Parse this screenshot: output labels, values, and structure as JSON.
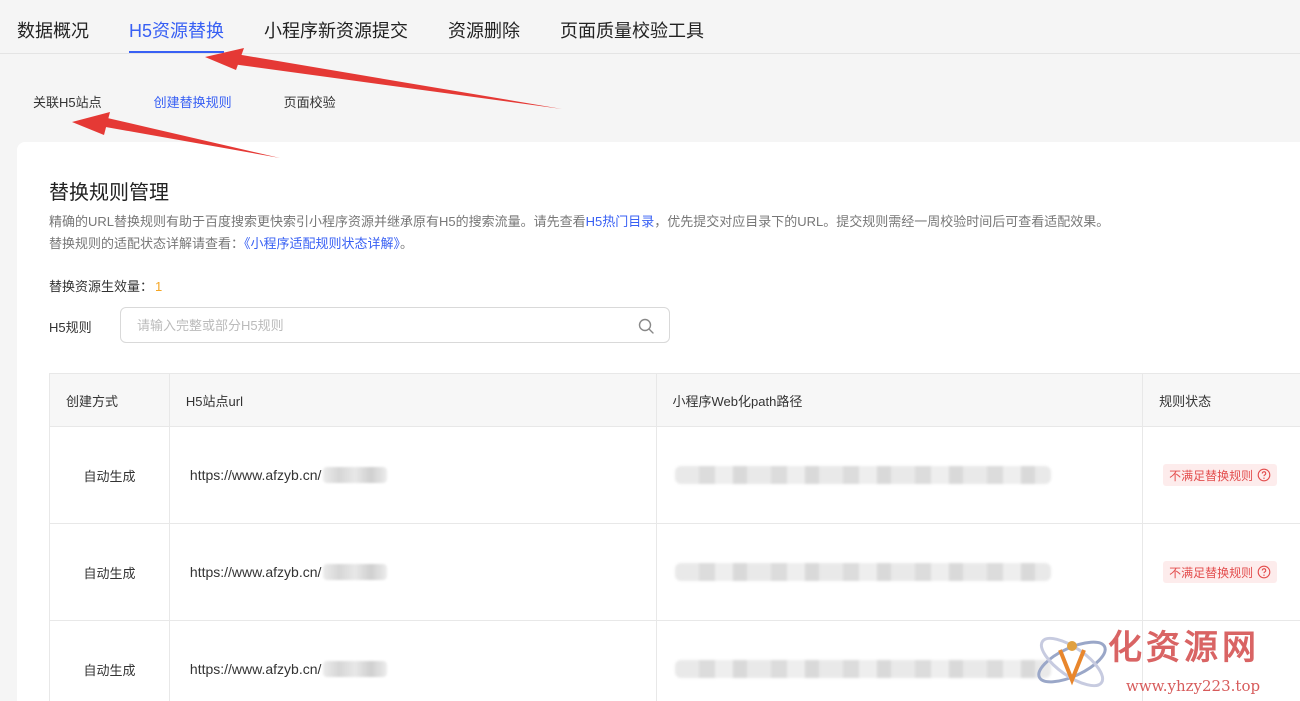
{
  "top_tabs": [
    {
      "label": "数据概况"
    },
    {
      "label": "H5资源替换"
    },
    {
      "label": "小程序新资源提交"
    },
    {
      "label": "资源删除"
    },
    {
      "label": "页面质量校验工具"
    }
  ],
  "sub_tabs": [
    {
      "label": "关联H5站点"
    },
    {
      "label": "创建替换规则"
    },
    {
      "label": "页面校验"
    }
  ],
  "card": {
    "title": "替换规则管理",
    "desc_line1_a": "精确的URL替换规则有助于百度搜索更快索引小程序资源并继承原有H5的搜索流量。请先查看",
    "desc_line1_link": "H5热门目录",
    "desc_line1_b": "，优先提交对应目录下的URL。提交规则需经一周校验时间后可查看适配效果。",
    "desc_line2_a": "替换规则的适配状态详解请查看：",
    "desc_line2_link": "《小程序适配规则状态详解》",
    "desc_line2_b": "。",
    "count_label": "替换资源生效量：",
    "count_value": "1",
    "filter_label": "H5规则",
    "search_placeholder": "请输入完整或部分H5规则"
  },
  "table": {
    "headers": [
      "创建方式",
      "H5站点url",
      "小程序Web化path路径",
      "规则状态"
    ],
    "rows": [
      {
        "method": "自动生成",
        "url": "https://www.afzyb.cn/",
        "status": "不满足替换规则"
      },
      {
        "method": "自动生成",
        "url": "https://www.afzyb.cn/",
        "status": "不满足替换规则"
      },
      {
        "method": "自动生成",
        "url": "https://www.afzyb.cn/",
        "status": ""
      }
    ]
  },
  "watermark": {
    "text": "化资源网",
    "url": "www.yhzy223.top"
  },
  "colors": {
    "accent": "#3860f4",
    "count": "#f5a623",
    "status_bg": "#fdecec",
    "status_text": "#e34d4d",
    "annotation_arrow": "#e53935"
  },
  "icons": {
    "search": "search-icon",
    "help": "help-circle-icon"
  }
}
